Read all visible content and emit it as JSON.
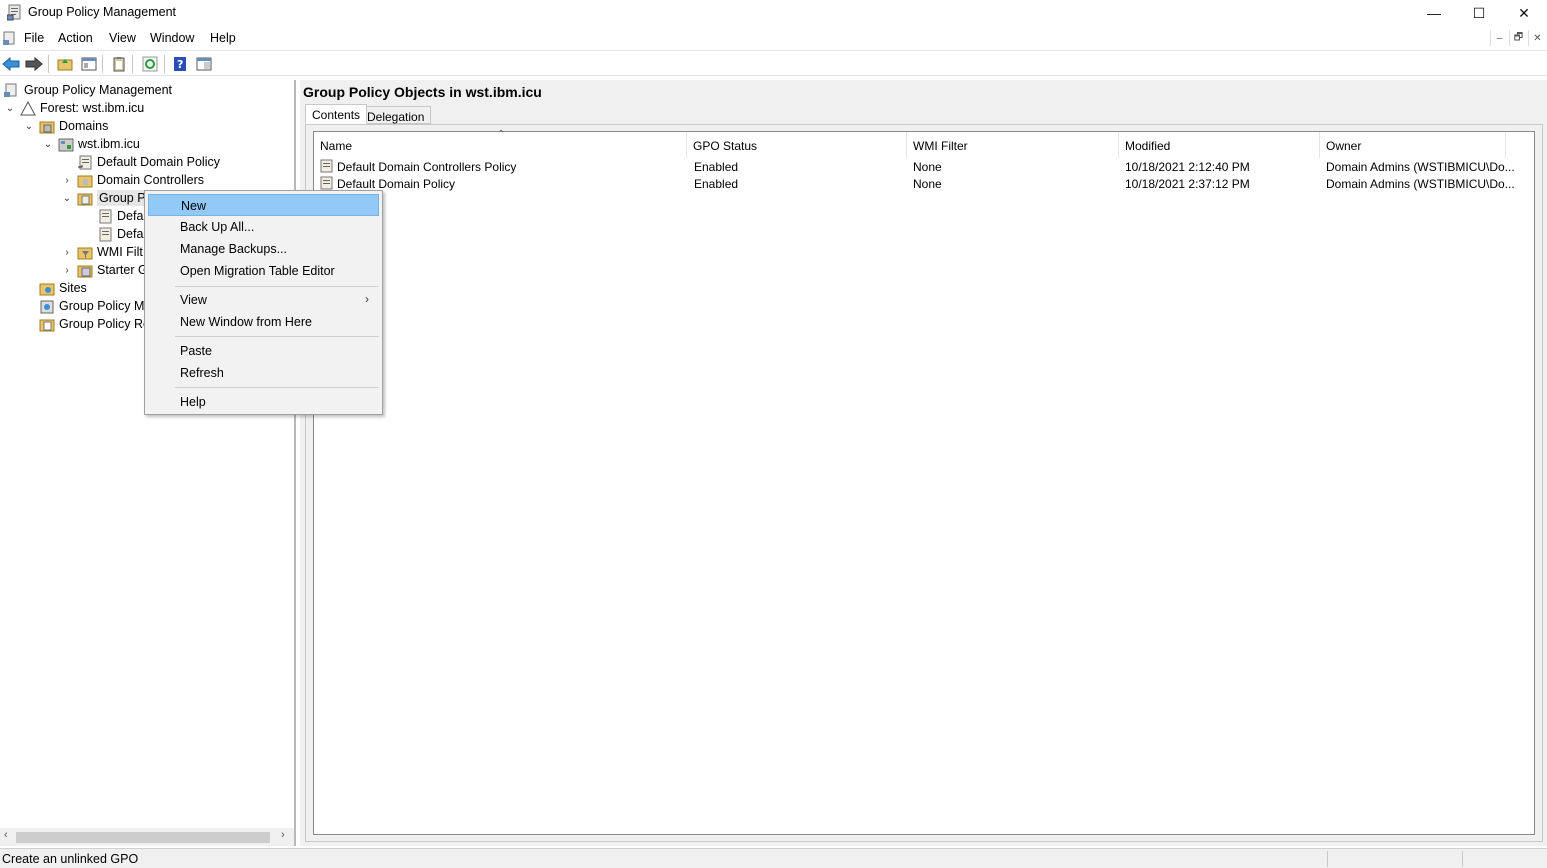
{
  "window": {
    "title": "Group Policy Management",
    "minimize": "—",
    "maximize": "☐",
    "close": "✕"
  },
  "menubar": {
    "items": [
      "File",
      "Action",
      "View",
      "Window",
      "Help"
    ],
    "mdi_min": "–",
    "mdi_restore": "🗗",
    "mdi_close": "✕"
  },
  "toolbar": {
    "buttons": [
      "back-icon",
      "forward-icon",
      "up-folder-icon",
      "show-hide-tree-icon",
      "clipboard-icon",
      "refresh-icon",
      "help-icon",
      "console-icon"
    ]
  },
  "tree": {
    "items": [
      {
        "label": "Group Policy Management",
        "chevron": "",
        "icon": "gpm-icon"
      },
      {
        "label": "Forest: wst.ibm.icu",
        "chevron": "⌄",
        "icon": "forest-icon"
      },
      {
        "label": "Domains",
        "chevron": "⌄",
        "icon": "domains-icon"
      },
      {
        "label": "wst.ibm.icu",
        "chevron": "⌄",
        "icon": "domain-icon"
      },
      {
        "label": "Default Domain Policy",
        "chevron": "",
        "icon": "gpo-link-icon"
      },
      {
        "label": "Domain Controllers",
        "chevron": "›",
        "icon": "ou-icon"
      },
      {
        "label": "Group P",
        "chevron": "⌄",
        "icon": "gpo-folder-icon"
      },
      {
        "label": "Defa",
        "chevron": "",
        "icon": "gpo-icon"
      },
      {
        "label": "Defa",
        "chevron": "",
        "icon": "gpo-icon"
      },
      {
        "label": "WMI Filt",
        "chevron": "›",
        "icon": "wmi-folder-icon"
      },
      {
        "label": "Starter G",
        "chevron": "›",
        "icon": "starter-folder-icon"
      },
      {
        "label": "Sites",
        "chevron": "",
        "icon": "sites-icon"
      },
      {
        "label": "Group Policy M",
        "chevron": "",
        "icon": "modeling-icon"
      },
      {
        "label": "Group Policy Re",
        "chevron": "",
        "icon": "results-icon"
      }
    ]
  },
  "right": {
    "title": "Group Policy Objects in wst.ibm.icu",
    "tabs": [
      "Contents",
      "Delegation"
    ],
    "columns": [
      "Name",
      "GPO Status",
      "WMI Filter",
      "Modified",
      "Owner"
    ],
    "rows": [
      {
        "name": "Default Domain Controllers Policy",
        "status": "Enabled",
        "wmi": "None",
        "modified": "10/18/2021 2:12:40 PM",
        "owner": "Domain Admins (WSTIBMICU\\Do..."
      },
      {
        "name": "Default Domain Policy",
        "status": "Enabled",
        "wmi": "None",
        "modified": "10/18/2021 2:37:12 PM",
        "owner": "Domain Admins (WSTIBMICU\\Do..."
      }
    ]
  },
  "context_menu": {
    "items": [
      "New",
      "Back Up All...",
      "Manage Backups...",
      "Open Migration Table Editor",
      "View",
      "New Window from Here",
      "Paste",
      "Refresh",
      "Help"
    ],
    "submenu_arrow": "›"
  },
  "status": {
    "text": "Create an unlinked GPO"
  },
  "colors": {
    "highlight": "#91c9f7",
    "selected_tree": "#e5e5e5"
  }
}
